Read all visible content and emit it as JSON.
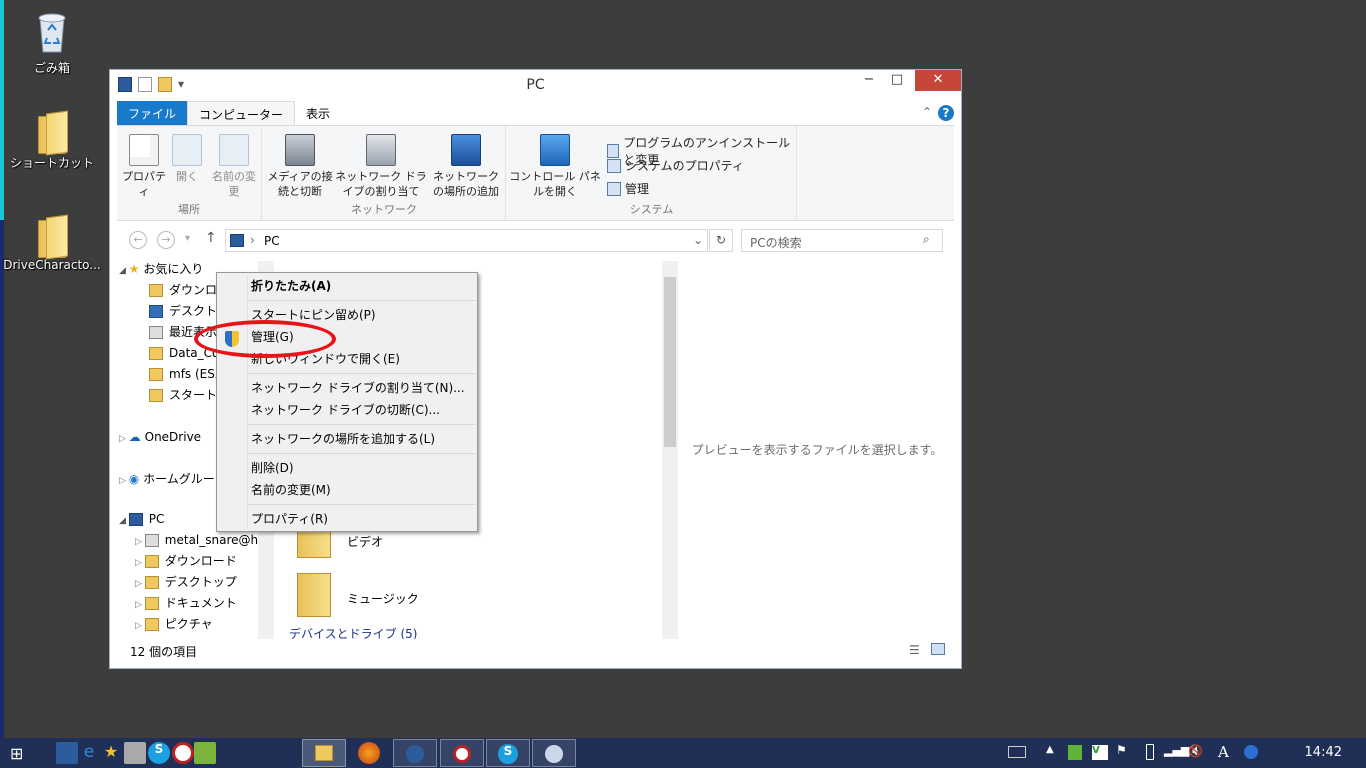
{
  "desktop": {
    "icons": [
      {
        "label": "ごみ箱"
      },
      {
        "label": "ショートカット"
      },
      {
        "label": "DriveCharacto..."
      }
    ]
  },
  "window": {
    "title": "PC",
    "controls": {
      "minimize": "−",
      "maximize": "□",
      "close": "✕"
    }
  },
  "ribbon_tabs": {
    "file": "ファイル",
    "computer": "コンピューター",
    "view": "表示"
  },
  "ribbon": {
    "location": {
      "label": "場所",
      "properties": "プロパティ",
      "open": "開く",
      "rename": "名前の変更"
    },
    "network": {
      "label": "ネットワーク",
      "media": "メディアの接続と切断",
      "map_drive": "ネットワーク ドライブの割り当て",
      "add_location": "ネットワークの場所の追加"
    },
    "system": {
      "label": "システム",
      "control_panel": "コントロール パネルを開く",
      "uninstall": "プログラムのアンインストールと変更",
      "sys_props": "システムのプロパティ",
      "manage": "管理"
    }
  },
  "address": {
    "path": "PC",
    "search_placeholder": "PCの検索"
  },
  "nav_tree": {
    "favorites": "お気に入り",
    "downloads": "ダウンロード",
    "desktop": "デスクトップ",
    "recent": "最近表示",
    "data_co": "Data_Co",
    "mfs": "mfs (ESX",
    "startup": "スタートアッ",
    "onedrive": "OneDrive",
    "homegroup": "ホームグルー",
    "pc": "PC",
    "metal": "metal_snare@h",
    "pc_downloads": "ダウンロード",
    "pc_desktop": "デスクトップ",
    "pc_documents": "ドキュメント",
    "pc_pictures": "ピクチャ"
  },
  "content": {
    "video": "ビデオ",
    "music": "ミュージック",
    "devices_header": "デバイスとドライブ (5)"
  },
  "preview_text": "プレビューを表示するファイルを選択します。",
  "status": {
    "count": "12 個の項目"
  },
  "context_menu": {
    "collapse": "折りたたみ(A)",
    "pin_start": "スタートにピン留め(P)",
    "manage": "管理(G)",
    "open_new": "新しいウィンドウで開く(E)",
    "map_drive": "ネットワーク ドライブの割り当て(N)...",
    "disconnect": "ネットワーク ドライブの切断(C)...",
    "add_location": "ネットワークの場所を追加する(L)",
    "delete": "削除(D)",
    "rename": "名前の変更(M)",
    "properties": "プロパティ(R)"
  },
  "taskbar": {
    "clock": "14:42"
  }
}
